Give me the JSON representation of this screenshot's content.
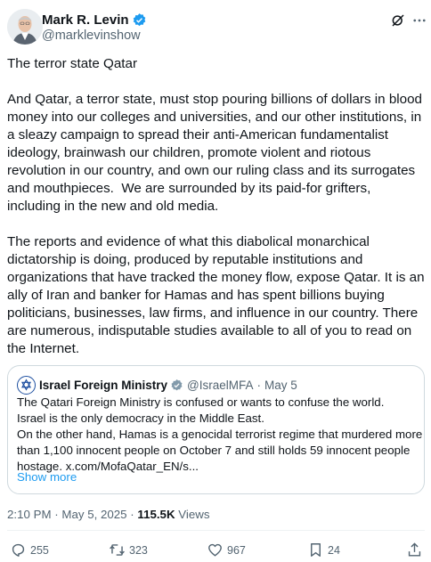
{
  "author": {
    "name": "Mark R. Levin",
    "handle": "@marklevinshow",
    "verified_color": "#1d9bf0"
  },
  "header_icons": [
    "grok-icon",
    "more-icon"
  ],
  "tweet": {
    "text": "The terror state Qatar\n\nAnd Qatar, a terror state, must stop pouring billions of dollars in blood money into our colleges and universities, and our other institutions, in a sleazy campaign to spread their anti-American fundamentalist ideology, brainwash our children, promote violent and riotous revolution in our country, and own our ruling class and its surrogates and mouthpieces.  We are surrounded by its paid-for grifters, including in the new and old media.\n\nThe reports and evidence of what this diabolical monarchical dictatorship is doing, produced by reputable institutions and organizations that have tracked the money flow, expose Qatar. It is an ally of Iran and banker for Hamas and has spent billions buying politicians, businesses, law firms, and influence in our country. There are numerous, indisputable studies available to all of you to read on the Internet."
  },
  "quote": {
    "name": "Israel Foreign Ministry",
    "handle": "@IsraelMFA",
    "separator": "·",
    "time": "May 5",
    "verified_color": "#829aab",
    "lines": [
      "The Qatari Foreign Ministry is confused or wants to confuse the world.",
      "Israel is the only democracy in the Middle East.",
      "On the other hand, Hamas is a genocidal terrorist regime that murdered more",
      "than 1,100 innocent people on October 7 and still holds 59 innocent people",
      "hostage. x.com/MofaQatar_EN/s..."
    ],
    "show_more": "Show more"
  },
  "meta": {
    "time": "2:10 PM",
    "separator": "·",
    "date": "May 5, 2025",
    "views_count": "115.5K",
    "views_label": "Views"
  },
  "actions": {
    "replies": "255",
    "reposts": "323",
    "likes": "967",
    "bookmarks": "24"
  },
  "colors": {
    "text": "#0f1419",
    "secondary": "#536471",
    "link": "#1d9bf0",
    "border": "#cfd9de"
  }
}
